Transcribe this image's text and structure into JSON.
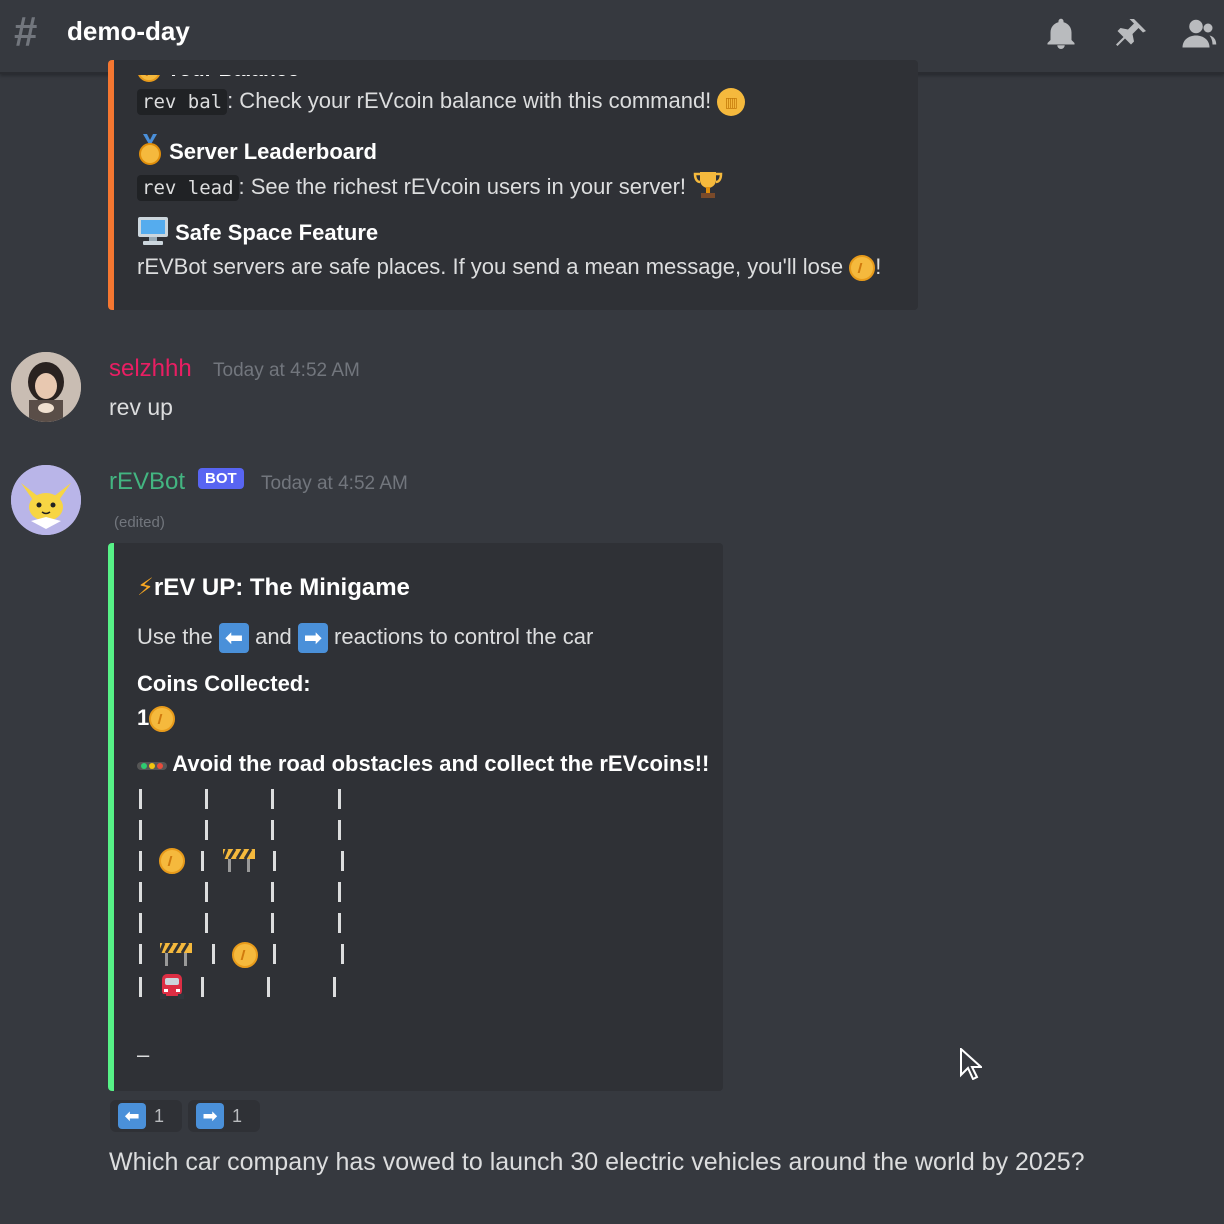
{
  "header": {
    "hash_symbol": "#",
    "channel_name": "demo-day"
  },
  "top_embed": {
    "partial_title": "Your Balance",
    "bal_command": "rev bal",
    "bal_text": ": Check your rEVcoin balance with this command!",
    "leaderboard_title": "Server Leaderboard",
    "lead_command": "rev lead",
    "lead_text": ": See the richest rEVcoin users in your server!",
    "safe_title": "Safe Space Feature",
    "safe_text": "rEVBot servers are safe places. If you send a mean message, you'll lose",
    "safe_end": "!",
    "accent_color": "#f57731"
  },
  "message_user": {
    "username": "selzhhh",
    "timestamp": "Today at 4:52 AM",
    "content": "rev up",
    "name_color": "#e91e63"
  },
  "message_bot": {
    "username": "rEVBot",
    "bot_tag": "BOT",
    "timestamp": "Today at 4:52 AM",
    "edited": "(edited)",
    "name_color": "#43b581"
  },
  "game_embed": {
    "title": "rEV UP: The Minigame",
    "instruction_pre": "Use the",
    "instruction_mid": "and",
    "instruction_post": "reactions to control the car",
    "coins_label": "Coins Collected:",
    "coins_value": "1",
    "avoid_text": "Avoid the road obstacles and collect the rEVcoins!!",
    "trailing_char": "–",
    "accent_color": "#57f287"
  },
  "reactions": [
    {
      "icon": "left-arrow-icon",
      "count": "1"
    },
    {
      "icon": "right-arrow-icon",
      "count": "1"
    }
  ],
  "question": "Which car company has vowed to launch 30 electric vehicles around the world by 2025?"
}
